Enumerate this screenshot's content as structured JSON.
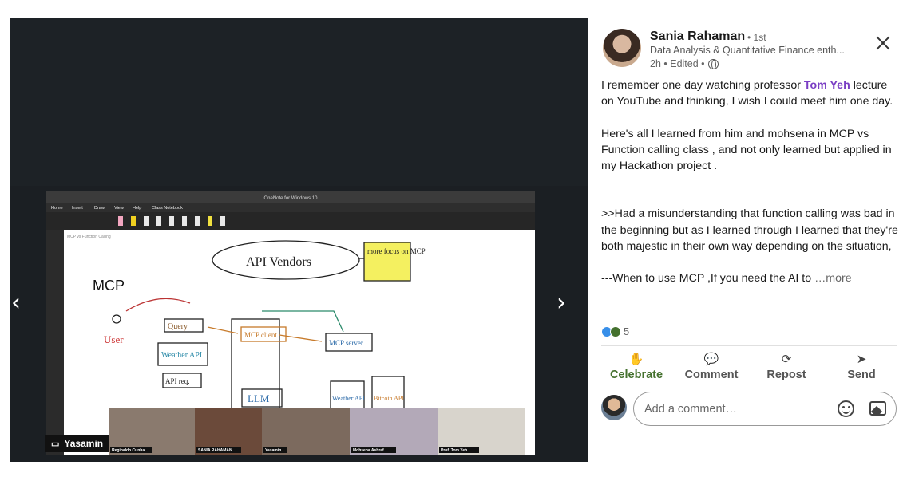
{
  "media": {
    "prev_arrow": "‹",
    "next_arrow": "›",
    "presenter_badge": "Yasamin"
  },
  "slide": {
    "app_title": "OneNote for Windows 10",
    "menu": [
      "Home",
      "Insert",
      "Draw",
      "View",
      "Help",
      "Class Notebook"
    ],
    "page_title": "MCP vs Function Calling",
    "labels": {
      "mcp": "MCP",
      "api_vendors": "API Vendors",
      "more_focus": "more focus on MCP",
      "user": "User",
      "query": "Query",
      "weather": "Weather API",
      "mcp_client": "MCP client",
      "mcp_server": "MCP server",
      "api_req": "API req.",
      "llm": "LLM",
      "weather_api": "Weather API",
      "bitcoin_api": "Bitcoin API"
    },
    "participants": [
      "Reginaldo Cunha",
      "SANIA RAHAMAN",
      "Yasamin",
      "Mohsena Ashraf",
      "Prof. Tom Yeh"
    ]
  },
  "post": {
    "author_name": "Sania Rahaman",
    "degree": "• 1st",
    "headline": "Data Analysis & Quantitative Finance enth...",
    "meta": "2h • Edited •",
    "body": {
      "p1_before": "I remember one day watching professor ",
      "mention": "Tom Yeh",
      "p1_after": " lecture on YouTube and thinking, I wish I could meet him one day.",
      "p2": "Here's all I learned from him and mohsena in MCP vs Function calling class , and not only learned but applied in my Hackathon project .",
      "p3": ">>Had a misunderstanding that function calling was bad in the beginning but as I learned through I learned that they're both majestic in their own way depending on the situation,",
      "p4": "---When to use MCP ,If you need the AI to ",
      "more": "…more"
    },
    "reaction_count": "5",
    "actions": [
      {
        "label": "Celebrate",
        "icon": "celebrate-icon"
      },
      {
        "label": "Comment",
        "icon": "comment-icon"
      },
      {
        "label": "Repost",
        "icon": "repost-icon"
      },
      {
        "label": "Send",
        "icon": "send-icon"
      }
    ],
    "comment_placeholder": "Add a comment…"
  }
}
